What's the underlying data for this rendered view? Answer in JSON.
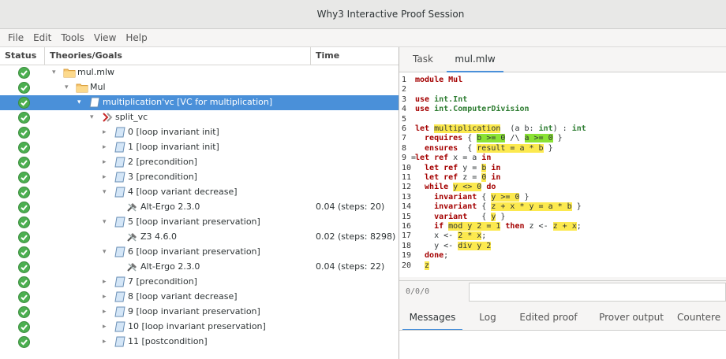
{
  "window": {
    "title": "Why3 Interactive Proof Session"
  },
  "menu": [
    "File",
    "Edit",
    "Tools",
    "View",
    "Help"
  ],
  "tree": {
    "columns": [
      "Status",
      "Theories/Goals",
      "Time"
    ],
    "rows": [
      {
        "depth": 0,
        "icon": "file",
        "label": "mul.mlw",
        "time": "",
        "expanded": "down"
      },
      {
        "depth": 1,
        "icon": "folder",
        "label": "Mul",
        "time": "",
        "expanded": "down"
      },
      {
        "depth": 2,
        "icon": "goal",
        "label": "multiplication'vc [VC for multiplication]",
        "time": "",
        "expanded": "down",
        "selected": true
      },
      {
        "depth": 3,
        "icon": "transform",
        "label": "split_vc",
        "time": "",
        "expanded": "down"
      },
      {
        "depth": 4,
        "icon": "goal",
        "label": "0 [loop invariant init]",
        "time": "",
        "expanded": "right"
      },
      {
        "depth": 4,
        "icon": "goal",
        "label": "1 [loop invariant init]",
        "time": "",
        "expanded": "right"
      },
      {
        "depth": 4,
        "icon": "goal",
        "label": "2 [precondition]",
        "time": "",
        "expanded": "right"
      },
      {
        "depth": 4,
        "icon": "goal",
        "label": "3 [precondition]",
        "time": "",
        "expanded": "right"
      },
      {
        "depth": 4,
        "icon": "goal",
        "label": "4 [loop variant decrease]",
        "time": "",
        "expanded": "down"
      },
      {
        "depth": 5,
        "icon": "prover",
        "label": "Alt-Ergo 2.3.0",
        "time": "0.04 (steps: 20)",
        "expanded": ""
      },
      {
        "depth": 4,
        "icon": "goal",
        "label": "5 [loop invariant preservation]",
        "time": "",
        "expanded": "down"
      },
      {
        "depth": 5,
        "icon": "prover",
        "label": "Z3 4.6.0",
        "time": "0.02 (steps: 8298)",
        "expanded": ""
      },
      {
        "depth": 4,
        "icon": "goal",
        "label": "6 [loop invariant preservation]",
        "time": "",
        "expanded": "down"
      },
      {
        "depth": 5,
        "icon": "prover",
        "label": "Alt-Ergo 2.3.0",
        "time": "0.04 (steps: 22)",
        "expanded": ""
      },
      {
        "depth": 4,
        "icon": "goal",
        "label": "7 [precondition]",
        "time": "",
        "expanded": "right"
      },
      {
        "depth": 4,
        "icon": "goal",
        "label": "8 [loop variant decrease]",
        "time": "",
        "expanded": "right"
      },
      {
        "depth": 4,
        "icon": "goal",
        "label": "9 [loop invariant preservation]",
        "time": "",
        "expanded": "right"
      },
      {
        "depth": 4,
        "icon": "goal",
        "label": "10 [loop invariant preservation]",
        "time": "",
        "expanded": "right"
      },
      {
        "depth": 4,
        "icon": "goal",
        "label": "11 [postcondition]",
        "time": "",
        "expanded": "right"
      }
    ]
  },
  "top_tabs": [
    "Task",
    "mul.mlw"
  ],
  "code": [
    {
      "n": "1",
      "parts": [
        [
          "kw",
          "module "
        ],
        [
          "kw",
          "Mul"
        ]
      ]
    },
    {
      "n": "2",
      "parts": []
    },
    {
      "n": "3",
      "parts": [
        [
          "kw",
          "use "
        ],
        [
          "ty",
          "int.Int"
        ]
      ]
    },
    {
      "n": "4",
      "parts": [
        [
          "kw",
          "use "
        ],
        [
          "ty",
          "int.ComputerDivision"
        ]
      ]
    },
    {
      "n": "5",
      "parts": []
    },
    {
      "n": "6",
      "parts": [
        [
          "kw",
          "let "
        ],
        [
          "hy",
          "multiplication"
        ],
        [
          "",
          "  (a b: "
        ],
        [
          "ty",
          "int"
        ],
        [
          "",
          ") : "
        ],
        [
          "ty",
          "int"
        ]
      ]
    },
    {
      "n": "7",
      "parts": [
        [
          "kw",
          "  requires "
        ],
        [
          "",
          "{ "
        ],
        [
          "hg",
          "b >= 0"
        ],
        [
          "",
          " /\\ "
        ],
        [
          "hg",
          "a >= 0"
        ],
        [
          "",
          " }"
        ]
      ]
    },
    {
      "n": "8",
      "parts": [
        [
          "kw",
          "  ensures  "
        ],
        [
          "",
          "{ "
        ],
        [
          "hy",
          "result = a * b"
        ],
        [
          "",
          " }"
        ]
      ]
    },
    {
      "n": "9 =",
      "parts": [
        [
          "kw",
          "let ref "
        ],
        [
          "",
          "x = a "
        ],
        [
          "kw",
          "in"
        ]
      ]
    },
    {
      "n": "10",
      "parts": [
        [
          "kw",
          "  let ref "
        ],
        [
          "",
          "y = "
        ],
        [
          "hy",
          "b"
        ],
        [
          "kw",
          " in"
        ]
      ]
    },
    {
      "n": "11",
      "parts": [
        [
          "kw",
          "  let ref "
        ],
        [
          "",
          "z = "
        ],
        [
          "hy",
          "0"
        ],
        [
          "kw",
          " in"
        ]
      ]
    },
    {
      "n": "12",
      "parts": [
        [
          "kw",
          "  while "
        ],
        [
          "hy",
          "y <> 0"
        ],
        [
          "kw",
          " do"
        ]
      ]
    },
    {
      "n": "13",
      "parts": [
        [
          "kw",
          "    invariant "
        ],
        [
          "",
          "{ "
        ],
        [
          "hy",
          "y >= 0"
        ],
        [
          "",
          " }"
        ]
      ]
    },
    {
      "n": "14",
      "parts": [
        [
          "kw",
          "    invariant "
        ],
        [
          "",
          "{ "
        ],
        [
          "hy",
          "z + x * y = a * b"
        ],
        [
          "",
          " }"
        ]
      ]
    },
    {
      "n": "15",
      "parts": [
        [
          "kw",
          "    variant   "
        ],
        [
          "",
          "{ "
        ],
        [
          "hy",
          "y"
        ],
        [
          "",
          " }"
        ]
      ]
    },
    {
      "n": "16",
      "parts": [
        [
          "kw",
          "    if "
        ],
        [
          "hy",
          "mod y 2 = 1"
        ],
        [
          "kw",
          " then "
        ],
        [
          "",
          "z <- "
        ],
        [
          "hy",
          "z + x"
        ],
        [
          "",
          ";"
        ]
      ]
    },
    {
      "n": "17",
      "parts": [
        [
          "",
          "    x <- "
        ],
        [
          "hy",
          "2 * x"
        ],
        [
          "",
          ";"
        ]
      ]
    },
    {
      "n": "18",
      "parts": [
        [
          "",
          "    y <- "
        ],
        [
          "hy",
          "div y 2"
        ]
      ]
    },
    {
      "n": "19",
      "parts": [
        [
          "kw",
          "  done"
        ],
        [
          "",
          ";"
        ]
      ]
    },
    {
      "n": "20",
      "parts": [
        [
          "",
          "  "
        ],
        [
          "hy",
          "z"
        ]
      ]
    }
  ],
  "status_position": "0/0/0",
  "bottom_tabs": [
    "Messages",
    "Log",
    "Edited proof",
    "Prover output",
    "Countere"
  ],
  "colors": {
    "selection": "#4a90d9",
    "valid": "#4caf50",
    "keyword": "#a40000",
    "highlight": "#fce94f",
    "highlight_green": "#8ae234"
  }
}
